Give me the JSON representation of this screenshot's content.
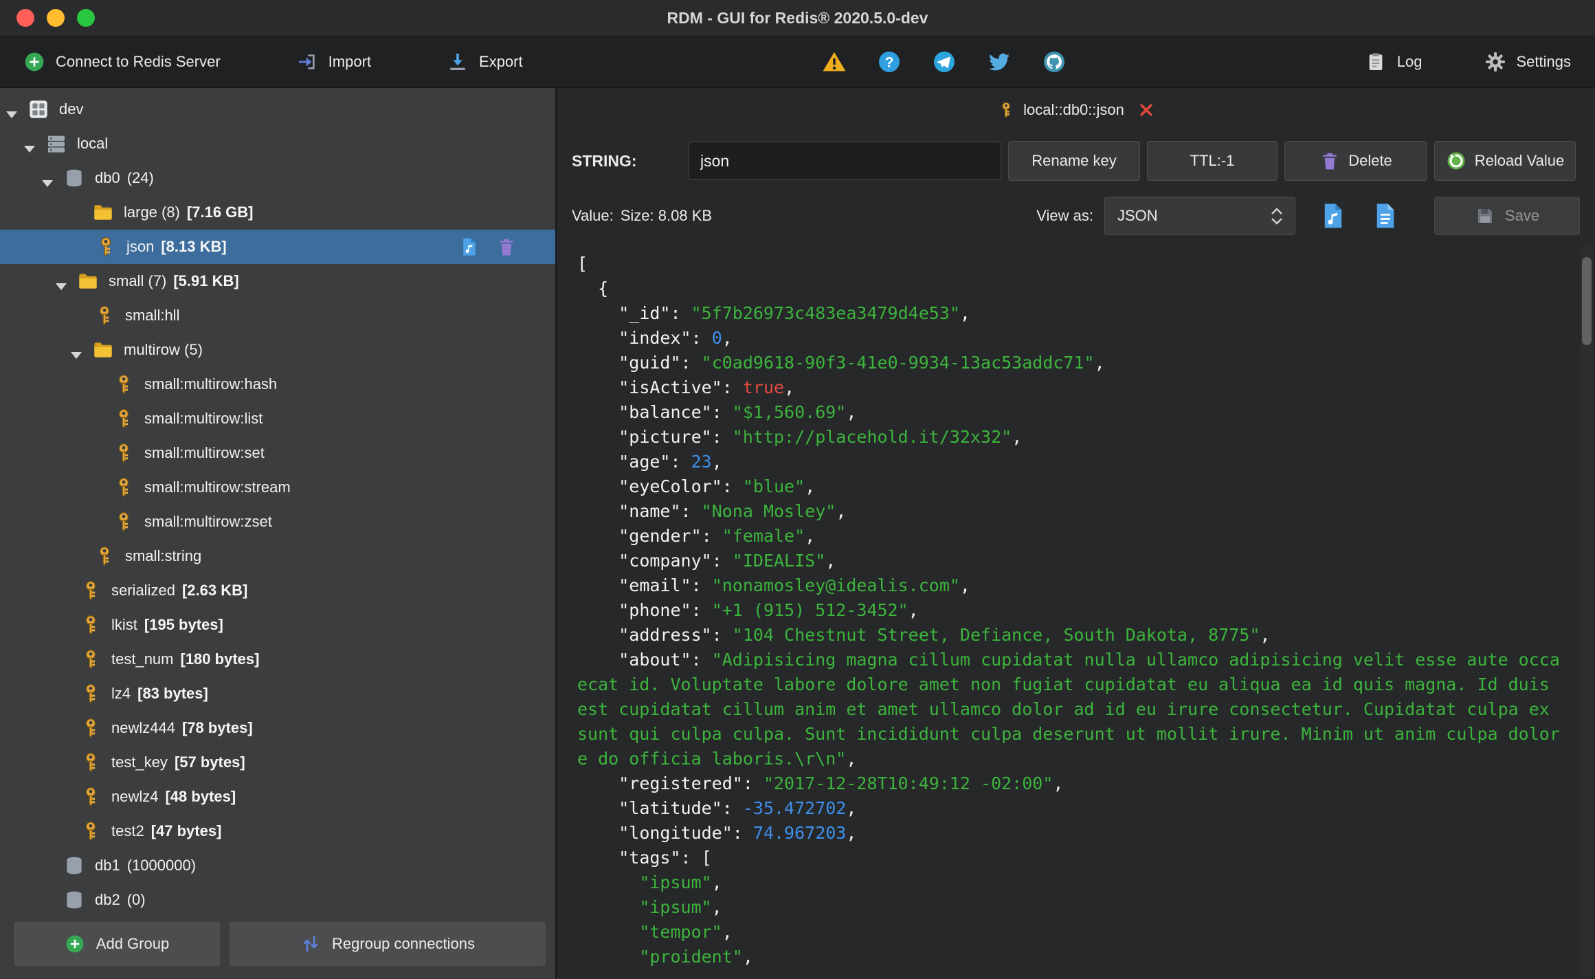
{
  "window": {
    "title": "RDM - GUI for Redis® 2020.5.0-dev"
  },
  "toolbar": {
    "connect_label": "Connect to Redis Server",
    "import_label": "Import",
    "export_label": "Export",
    "log_label": "Log",
    "settings_label": "Settings",
    "status_icons": [
      "warning-icon",
      "help-icon",
      "telegram-icon",
      "twitter-icon",
      "github-icon"
    ]
  },
  "sidebar": {
    "add_group_label": "Add Group",
    "regroup_label": "Regroup connections",
    "tree": [
      {
        "label": "dev",
        "icon": "connection",
        "ind": 40,
        "arrow": true
      },
      {
        "label": "local",
        "icon": "server",
        "ind": 66,
        "arrow": true
      },
      {
        "label": "db0",
        "count": "(24)",
        "icon": "database",
        "ind": 92,
        "arrow": true
      },
      {
        "label": "large (8)",
        "size": "[7.16 GB]",
        "icon": "folder",
        "ind": 134
      },
      {
        "label": "json",
        "size": "[8.13 KB]",
        "icon": "key",
        "ind": 138,
        "selected": true
      },
      {
        "label": "small (7)",
        "size": "[5.91 KB]",
        "icon": "folder",
        "ind": 112,
        "arrow": true
      },
      {
        "label": "small:hll",
        "icon": "key",
        "ind": 136
      },
      {
        "label": "multirow (5)",
        "icon": "folder",
        "ind": 134,
        "arrow": true
      },
      {
        "label": "small:multirow:hash",
        "icon": "key",
        "ind": 164
      },
      {
        "label": "small:multirow:list",
        "icon": "key",
        "ind": 164
      },
      {
        "label": "small:multirow:set",
        "icon": "key",
        "ind": 164
      },
      {
        "label": "small:multirow:stream",
        "icon": "key",
        "ind": 164
      },
      {
        "label": "small:multirow:zset",
        "icon": "key",
        "ind": 164
      },
      {
        "label": "small:string",
        "icon": "key",
        "ind": 136
      },
      {
        "label": "serialized",
        "size": "[2.63 KB]",
        "icon": "key",
        "ind": 116
      },
      {
        "label": "lkist",
        "size": "[195 bytes]",
        "icon": "key",
        "ind": 116
      },
      {
        "label": "test_num",
        "size": "[180 bytes]",
        "icon": "key",
        "ind": 116
      },
      {
        "label": "lz4",
        "size": "[83 bytes]",
        "icon": "key",
        "ind": 116
      },
      {
        "label": "newlz444",
        "size": "[78 bytes]",
        "icon": "key",
        "ind": 116
      },
      {
        "label": "test_key",
        "size": "[57 bytes]",
        "icon": "key",
        "ind": 116
      },
      {
        "label": "newlz4",
        "size": "[48 bytes]",
        "icon": "key",
        "ind": 116
      },
      {
        "label": "test2",
        "size": "[47 bytes]",
        "icon": "key",
        "ind": 116
      },
      {
        "label": "db1",
        "count": "(1000000)",
        "icon": "database",
        "ind": 92
      },
      {
        "label": "db2",
        "count": "(0)",
        "icon": "database",
        "ind": 92
      }
    ]
  },
  "main": {
    "tab": {
      "label": "local::db0::json"
    },
    "key_editor": {
      "type_label": "STRING:",
      "key_name": "json",
      "rename_label": "Rename key",
      "ttl_label": "TTL:-1",
      "delete_label": "Delete",
      "reload_label": "Reload Value"
    },
    "value_bar": {
      "value_label": "Value:",
      "size_label": "Size: 8.08 KB",
      "view_as_label": "View as:",
      "view_as_value": "JSON",
      "save_label": "Save"
    },
    "editor": {
      "lines": [
        [
          [
            "w",
            "["
          ]
        ],
        [
          [
            "w",
            "  {"
          ]
        ],
        [
          [
            "w",
            "    \"_id\": "
          ],
          [
            "s",
            "\"5f7b26973c483ea3479d4e53\""
          ],
          [
            "w",
            ","
          ]
        ],
        [
          [
            "w",
            "    \"index\": "
          ],
          [
            "n",
            "0"
          ],
          [
            "w",
            ","
          ]
        ],
        [
          [
            "w",
            "    \"guid\": "
          ],
          [
            "s",
            "\"c0ad9618-90f3-41e0-9934-13ac53addc71\""
          ],
          [
            "w",
            ","
          ]
        ],
        [
          [
            "w",
            "    \"isActive\": "
          ],
          [
            "b",
            "true"
          ],
          [
            "w",
            ","
          ]
        ],
        [
          [
            "w",
            "    \"balance\": "
          ],
          [
            "s",
            "\"$1,560.69\""
          ],
          [
            "w",
            ","
          ]
        ],
        [
          [
            "w",
            "    \"picture\": "
          ],
          [
            "s",
            "\"http://placehold.it/32x32\""
          ],
          [
            "w",
            ","
          ]
        ],
        [
          [
            "w",
            "    \"age\": "
          ],
          [
            "n",
            "23"
          ],
          [
            "w",
            ","
          ]
        ],
        [
          [
            "w",
            "    \"eyeColor\": "
          ],
          [
            "s",
            "\"blue\""
          ],
          [
            "w",
            ","
          ]
        ],
        [
          [
            "w",
            "    \"name\": "
          ],
          [
            "s",
            "\"Nona Mosley\""
          ],
          [
            "w",
            ","
          ]
        ],
        [
          [
            "w",
            "    \"gender\": "
          ],
          [
            "s",
            "\"female\""
          ],
          [
            "w",
            ","
          ]
        ],
        [
          [
            "w",
            "    \"company\": "
          ],
          [
            "s",
            "\"IDEALIS\""
          ],
          [
            "w",
            ","
          ]
        ],
        [
          [
            "w",
            "    \"email\": "
          ],
          [
            "s",
            "\"nonamosley@idealis.com\""
          ],
          [
            "w",
            ","
          ]
        ],
        [
          [
            "w",
            "    \"phone\": "
          ],
          [
            "s",
            "\"+1 (915) 512-3452\""
          ],
          [
            "w",
            ","
          ]
        ],
        [
          [
            "w",
            "    \"address\": "
          ],
          [
            "s",
            "\"104 Chestnut Street, Defiance, South Dakota, 8775\""
          ],
          [
            "w",
            ","
          ]
        ],
        [
          [
            "w",
            "    \"about\": "
          ],
          [
            "s",
            "\"Adipisicing magna cillum cupidatat nulla ullamco adipisicing velit esse aute occaecat id. Voluptate labore dolore amet non fugiat cupidatat eu aliqua ea id quis magna. Id duis est cupidatat cillum anim et amet ullamco dolor ad id eu irure consectetur. Cupidatat culpa ex sunt qui culpa culpa. Sunt incididunt culpa deserunt ut mollit irure. Minim ut anim culpa dolore do officia laboris.\\r\\n\""
          ],
          [
            "w",
            ","
          ]
        ],
        [
          [
            "w",
            "    \"registered\": "
          ],
          [
            "s",
            "\"2017-12-28T10:49:12 -02:00\""
          ],
          [
            "w",
            ","
          ]
        ],
        [
          [
            "w",
            "    \"latitude\": "
          ],
          [
            "n",
            "-35.472702"
          ],
          [
            "w",
            ","
          ]
        ],
        [
          [
            "w",
            "    \"longitude\": "
          ],
          [
            "n",
            "74.967203"
          ],
          [
            "w",
            ","
          ]
        ],
        [
          [
            "w",
            "    \"tags\": ["
          ]
        ],
        [
          [
            "w",
            "      "
          ],
          [
            "s",
            "\"ipsum\""
          ],
          [
            "w",
            ","
          ]
        ],
        [
          [
            "w",
            "      "
          ],
          [
            "s",
            "\"ipsum\""
          ],
          [
            "w",
            ","
          ]
        ],
        [
          [
            "w",
            "      "
          ],
          [
            "s",
            "\"tempor\""
          ],
          [
            "w",
            ","
          ]
        ],
        [
          [
            "w",
            "      "
          ],
          [
            "s",
            "\"proident\""
          ],
          [
            "w",
            ","
          ]
        ]
      ]
    }
  },
  "colors": {
    "selection": "#3c6d9c",
    "json_string": "#3cb43c",
    "json_number": "#3e8fe8",
    "json_keyword": "#e24a42",
    "key_icon_gold": "#e8a93a"
  }
}
